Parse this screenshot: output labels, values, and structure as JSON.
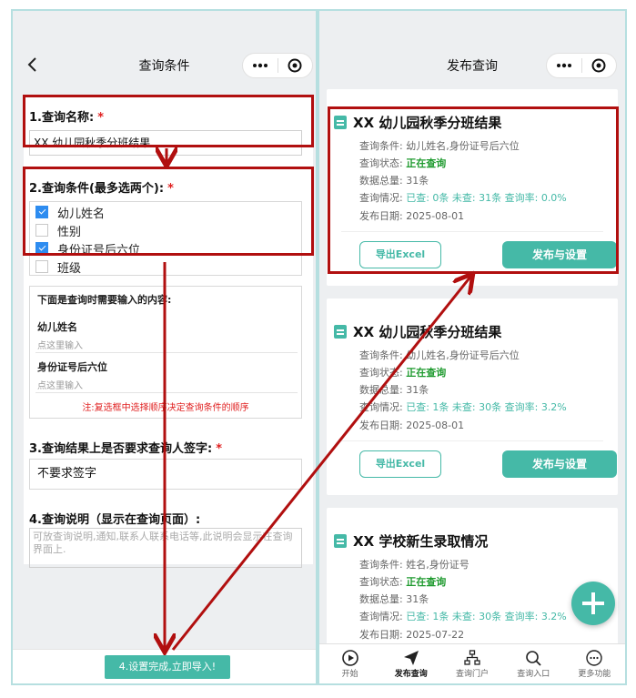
{
  "left": {
    "nav_title": "查询条件",
    "fields": {
      "name_label": "1.查询名称:",
      "name_value": "XX 幼儿园秋季分班结果",
      "conditions_label": "2.查询条件(最多选两个):",
      "options": [
        {
          "label": "幼儿姓名",
          "checked": true
        },
        {
          "label": "性别",
          "checked": false
        },
        {
          "label": "身份证号后六位",
          "checked": true
        },
        {
          "label": "班级",
          "checked": false
        }
      ],
      "inputs_hint": "下面是查询时需要输入的内容:",
      "inputs": [
        {
          "title": "幼儿姓名",
          "placeholder": "点这里输入"
        },
        {
          "title": "身份证号后六位",
          "placeholder": "点这里输入"
        }
      ],
      "order_note": "注:复选框中选择顺序决定查询条件的顺序",
      "signature_label": "3.查询结果上是否要求查询人签字:",
      "signature_value": "不要求签字",
      "desc_label": "4.查询说明（显示在查询页面）:",
      "desc_placeholder": "可放查询说明,通知,联系人联系电话等,此说明会显示在查询界面上."
    },
    "required_mark": "*",
    "submit_button": "4.设置完成,立即导入!"
  },
  "right": {
    "nav_title": "发布查询",
    "info_labels": {
      "conditions": "查询条件:",
      "status": "查询状态:",
      "total": "数据总量:",
      "situation": "查询情况:",
      "date": "发布日期:"
    },
    "cards": [
      {
        "title": "XX 幼儿园秋季分班结果",
        "conditions": "幼儿姓名,身份证号后六位",
        "status": "正在查询",
        "total": "31条",
        "situation": "已查: 0条 未查: 31条 查询率: 0.0%",
        "date": "2025-08-01",
        "excel_button": "导出Excel",
        "publish_button": "发布与设置"
      },
      {
        "title": "XX 幼儿园秋季分班结果",
        "conditions": "幼儿姓名,身份证号后六位",
        "status": "正在查询",
        "total": "31条",
        "situation": "已查: 1条 未查: 30条 查询率: 3.2%",
        "date": "2025-08-01",
        "excel_button": "导出Excel",
        "publish_button": "发布与设置"
      },
      {
        "title": "XX 学校新生录取情况",
        "conditions": "姓名,身份证号",
        "status": "正在查询",
        "total": "31条",
        "situation": "已查: 1条 未查: 30条 查询率: 3.2%",
        "date": "2025-07-22"
      }
    ],
    "tabs": [
      {
        "label": "开始",
        "icon": "play-circle-icon"
      },
      {
        "label": "发布查询",
        "icon": "send-icon",
        "active": true
      },
      {
        "label": "查询门户",
        "icon": "sitemap-icon"
      },
      {
        "label": "查询入口",
        "icon": "search-icon"
      },
      {
        "label": "更多功能",
        "icon": "more-icon"
      }
    ]
  },
  "colors": {
    "accent": "#45b9a7",
    "annotation_red": "#b10f0f",
    "status_green": "#1e9a2e",
    "required_red": "#e02020",
    "checkbox_blue": "#2d8cf0"
  }
}
